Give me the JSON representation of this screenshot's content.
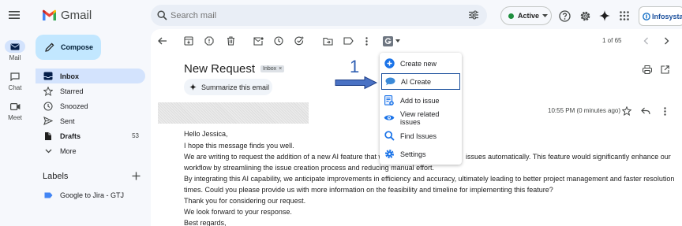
{
  "app": {
    "name": "Gmail"
  },
  "search": {
    "placeholder": "Search mail"
  },
  "status": {
    "label": "Active",
    "color": "#1e8e3e"
  },
  "org": {
    "label": "Infosysta"
  },
  "rail": {
    "items": [
      {
        "label": "Mail",
        "icon": "mail-icon"
      },
      {
        "label": "Chat",
        "icon": "chat-icon"
      },
      {
        "label": "Meet",
        "icon": "meet-icon"
      }
    ]
  },
  "compose": {
    "label": "Compose"
  },
  "nav": {
    "inbox": {
      "label": "Inbox"
    },
    "starred": {
      "label": "Starred"
    },
    "snoozed": {
      "label": "Snoozed"
    },
    "sent": {
      "label": "Sent"
    },
    "drafts": {
      "label": "Drafts",
      "count": "53"
    },
    "more": {
      "label": "More"
    }
  },
  "labels": {
    "title": "Labels",
    "items": [
      {
        "label": "Google to Jira - GTJ",
        "color": "#4285f4"
      }
    ]
  },
  "toolbar": {
    "pagination": "1 of 65"
  },
  "email": {
    "subject": "New Request",
    "tag": "Inbox",
    "summarize_label": "Summarize this email",
    "time": "10:55 PM (0 minutes ago)",
    "lines": [
      "Hello Jessica,",
      "I hope this message finds you well.",
      "We are writing to request the addition of a new AI feature that w",
      "workflow by streamlining the issue creation process and reducing manual effort.",
      "By integrating this AI capability, we anticipate improvements in efficiency and accuracy, ultimately leading to better project management and faster resolution",
      "times. Could you please provide us with more information on the feasibility and timeline for implementing this feature?",
      "Thank you for considering our request.",
      "We look forward to your response.",
      "Best regards,"
    ],
    "line3_tail": "issues automatically. This feature would significantly enhance our"
  },
  "annotation": {
    "step": "1",
    "color": "#2f5fb3"
  },
  "menu": {
    "items": [
      {
        "label": "Create new",
        "icon": "plus-circle-icon"
      },
      {
        "label": "AI Create",
        "icon": "ai-chat-icon"
      },
      {
        "label": "Add to issue",
        "icon": "add-to-issue-icon"
      },
      {
        "label": "View related issues",
        "icon": "eye-icon"
      },
      {
        "label": "Find Issues",
        "icon": "search-icon"
      },
      {
        "label": "Settings",
        "icon": "gear-icon"
      }
    ]
  },
  "colors": {
    "accent": "#0b57d0",
    "brand_red": "#ea4335",
    "selected_nav": "#d3e3fd",
    "compose_bg": "#c2e7ff"
  }
}
